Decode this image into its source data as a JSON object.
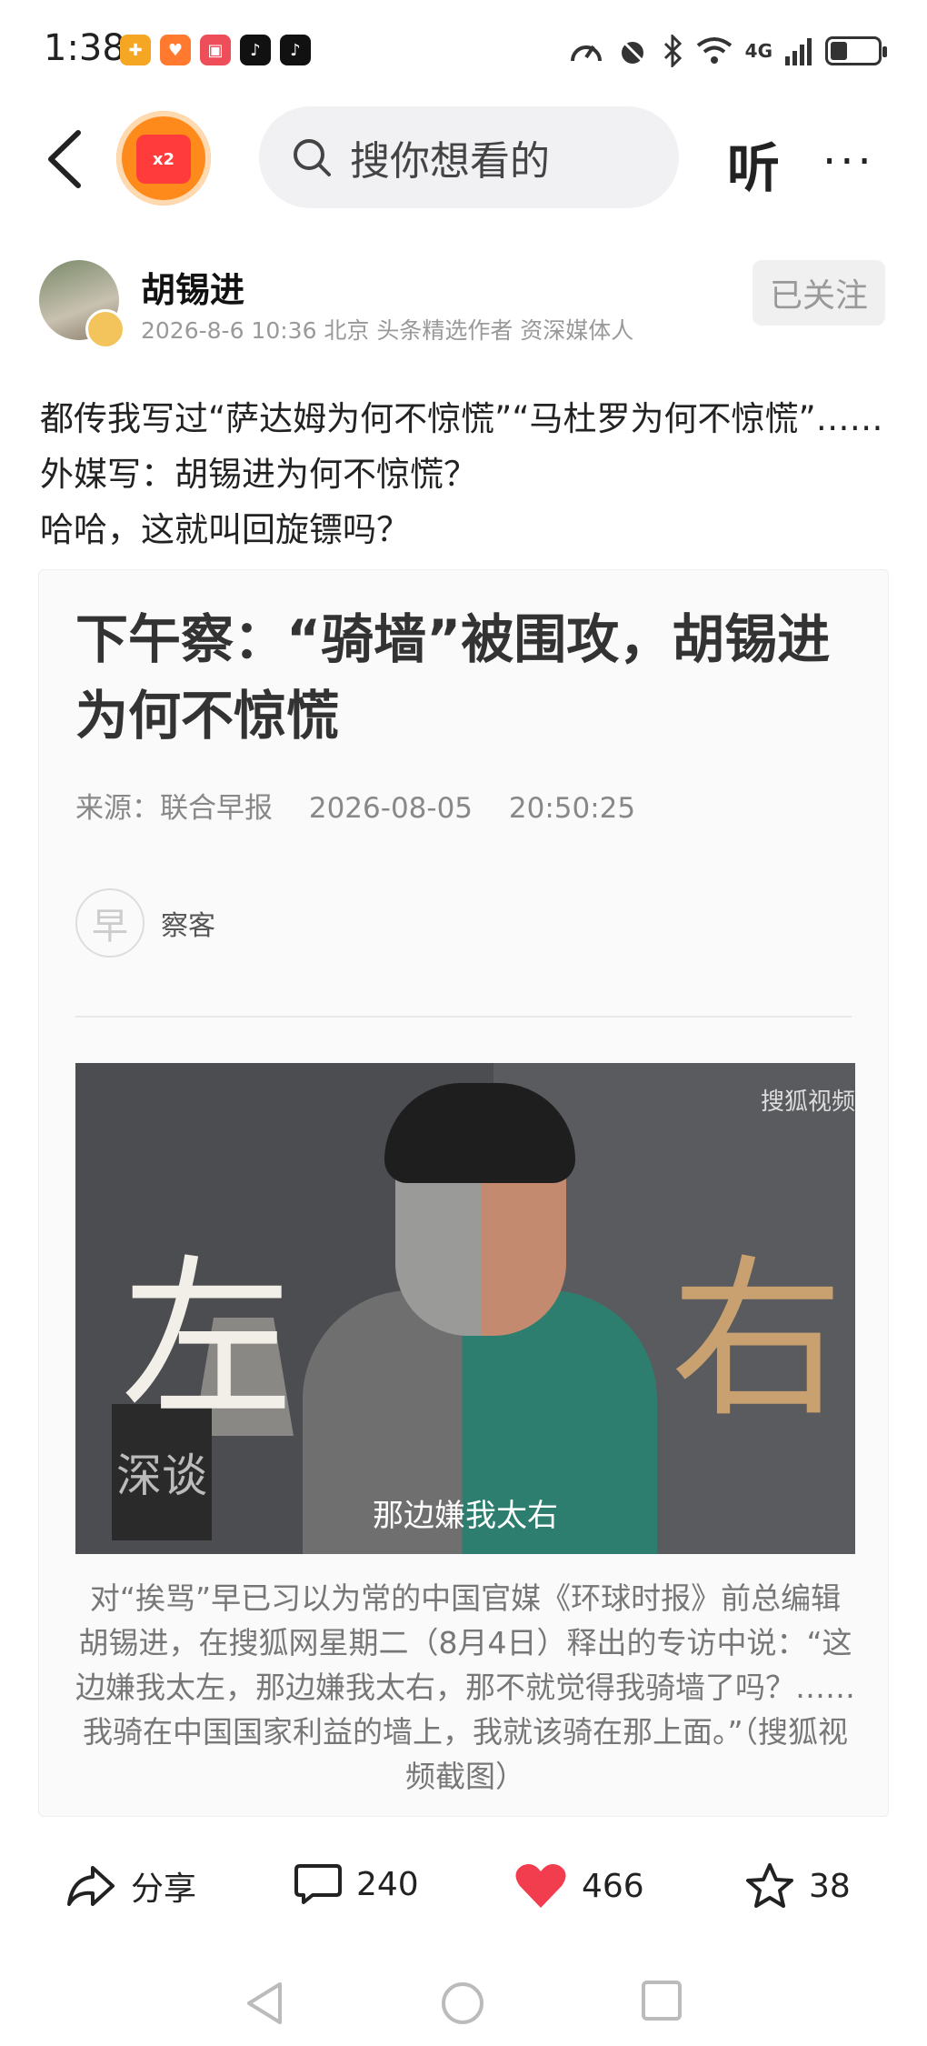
{
  "status_bar": {
    "time": "1:38",
    "network": "4G",
    "battery_percent": 35
  },
  "nav": {
    "coin_badge": "x2",
    "search_placeholder": "搜你想看的",
    "listen_label": "听",
    "more_label": "···"
  },
  "author": {
    "name": "胡锡进",
    "meta": "2026-8-6 10:36 北京 头条精选作者 资深媒体人",
    "follow_label": "已关注"
  },
  "post": {
    "text": "都传我写过“萨达姆为何不惊慌”“马杜罗为何不惊慌”……外媒写：胡锡进为何不惊慌？\n哈哈，这就叫回旋镖吗？"
  },
  "card": {
    "title": "下午察：“骑墙”被围攻，胡锡进为何不惊慌",
    "source": "来源：联合早报",
    "datetime": "2026-08-05 20:50:25",
    "logo_char": "早",
    "column": "察客",
    "photo_left_char": "左",
    "photo_right_char": "右",
    "photo_subtitle": "那边嫌我太右",
    "photo_watermark": "搜狐视频",
    "photo_book_text": "深谈",
    "caption": "对“挨骂”早已习以为常的中国官媒《环球时报》前总编辑胡锡进，在搜狐网星期二（8月4日）释出的专访中说：“这边嫌我太左，那边嫌我太右，那不就觉得我骑墙了吗？……我骑在中国国家利益的墙上，我就该骑在那上面。”（搜狐视频截图）"
  },
  "actions": {
    "share_label": "分享",
    "comment_count": "240",
    "like_count": "466",
    "favorite_count": "38"
  },
  "colors": {
    "like_red": "#f23d4f",
    "coin_orange": "#ff8a1c"
  }
}
